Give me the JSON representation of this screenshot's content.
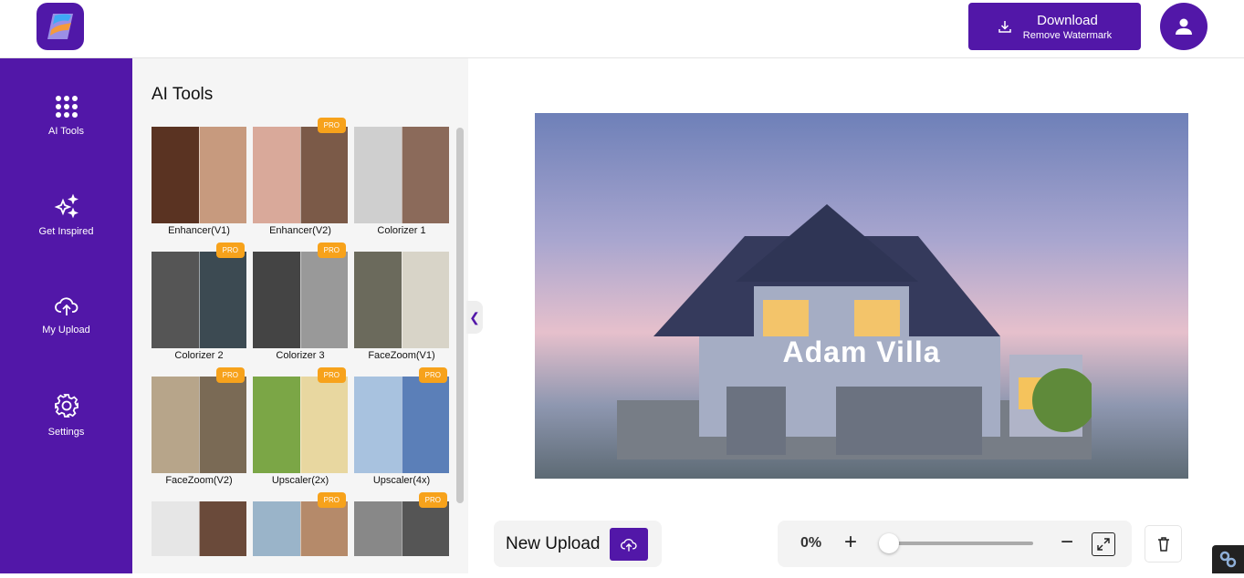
{
  "header": {
    "download_label": "Download",
    "download_sublabel": "Remove Watermark"
  },
  "sidebar": {
    "items": [
      {
        "label": "AI Tools",
        "icon": "grid-dots-icon"
      },
      {
        "label": "Get Inspired",
        "icon": "sparkles-icon"
      },
      {
        "label": "My Upload",
        "icon": "cloud-upload-icon"
      },
      {
        "label": "Settings",
        "icon": "gear-icon"
      }
    ]
  },
  "panel": {
    "title": "AI Tools",
    "tools": [
      {
        "label": "Enhancer(V1)",
        "pro": false,
        "colors": [
          "#5a3322",
          "#c79a7e"
        ]
      },
      {
        "label": "Enhancer(V2)",
        "pro": true,
        "colors": [
          "#d9a99a",
          "#7b5a48"
        ]
      },
      {
        "label": "Colorizer 1",
        "pro": false,
        "colors": [
          "#cfcfcf",
          "#8b6a5a"
        ]
      },
      {
        "label": "Colorizer 2",
        "pro": true,
        "colors": [
          "#555",
          "#3c4a52"
        ]
      },
      {
        "label": "Colorizer 3",
        "pro": true,
        "colors": [
          "#444",
          "#999"
        ]
      },
      {
        "label": "FaceZoom(V1)",
        "pro": false,
        "colors": [
          "#6b6a5c",
          "#d8d4c8"
        ]
      },
      {
        "label": "FaceZoom(V2)",
        "pro": true,
        "colors": [
          "#b7a58a",
          "#7a6a55"
        ]
      },
      {
        "label": "Upscaler(2x)",
        "pro": true,
        "colors": [
          "#7ba646",
          "#e8d7a0"
        ]
      },
      {
        "label": "Upscaler(4x)",
        "pro": true,
        "colors": [
          "#a8c2df",
          "#5b7fb8"
        ]
      },
      {
        "label": "",
        "pro": false,
        "colors": [
          "#e6e6e6",
          "#6a4a3a"
        ]
      },
      {
        "label": "",
        "pro": true,
        "colors": [
          "#9ab4c9",
          "#b58a6a"
        ]
      },
      {
        "label": "",
        "pro": true,
        "colors": [
          "#888",
          "#555"
        ]
      }
    ],
    "pro_label": "PRO"
  },
  "canvas": {
    "overlay_text": "Adam Villa"
  },
  "bottom": {
    "new_upload_label": "New Upload",
    "zoom_value": "0%",
    "zoom_slider_fraction": 0
  },
  "colors": {
    "brand": "#5217a8",
    "pro": "#f7a21b"
  }
}
